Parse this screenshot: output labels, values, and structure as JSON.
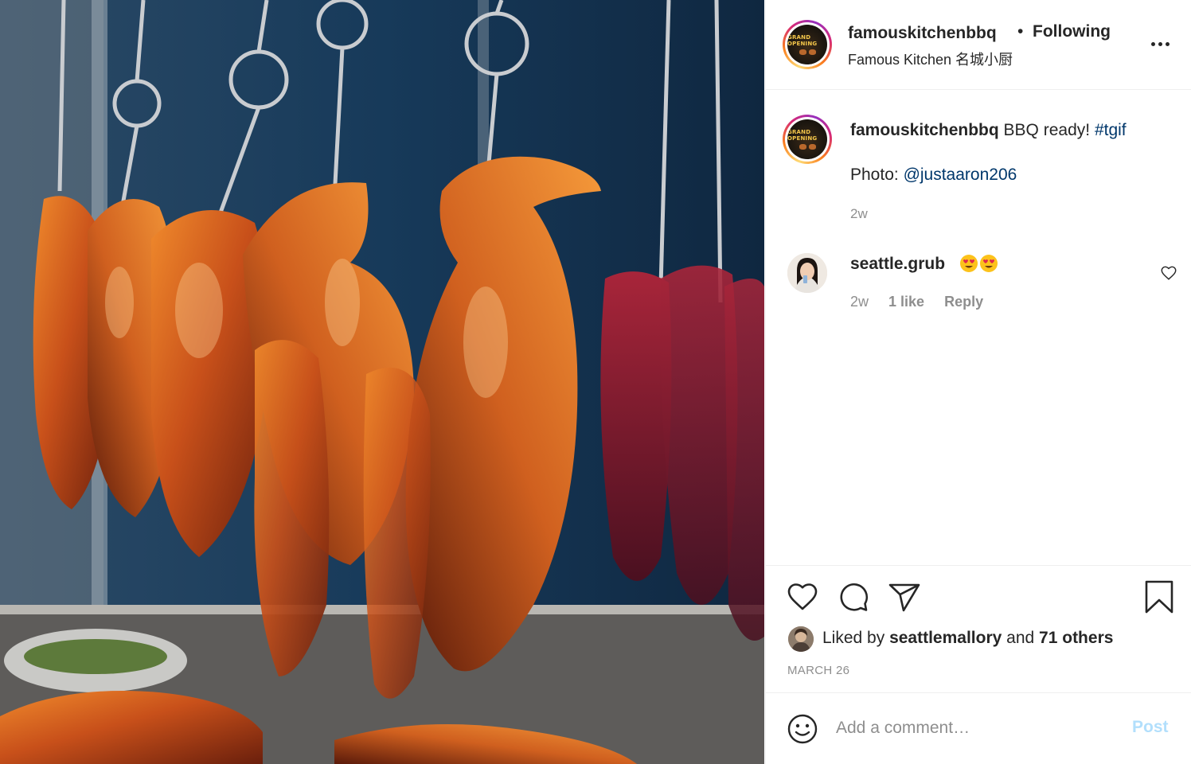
{
  "header": {
    "username": "famouskitchenbbq",
    "separator": "•",
    "follow_status": "Following",
    "location": "Famous Kitchen 名城小厨",
    "more_icon": "ellipsis-icon",
    "avatar_badge": "GRAND OPENING"
  },
  "caption": {
    "username": "famouskitchenbbq",
    "text": "BBQ ready!",
    "hashtag": "#tgif",
    "photo_label": "Photo:",
    "photo_credit": "@justaaron206",
    "time": "2w"
  },
  "comments": [
    {
      "username": "seattle.grub",
      "emoji": "😍😍",
      "time": "2w",
      "likes": "1 like",
      "reply_label": "Reply"
    }
  ],
  "actions": {
    "like_icon": "heart-icon",
    "comment_icon": "comment-icon",
    "share_icon": "paper-plane-icon",
    "save_icon": "bookmark-icon"
  },
  "likes": {
    "prefix": "Liked by",
    "user": "seattlemallory",
    "conjunction": "and",
    "others": "71 others"
  },
  "date": "MARCH 26",
  "add_comment": {
    "placeholder": "Add a comment…",
    "post_label": "Post"
  },
  "colors": {
    "link": "#00376b",
    "muted": "#8e8e8e",
    "post_disabled": "#b2dffc",
    "text": "#262626"
  }
}
